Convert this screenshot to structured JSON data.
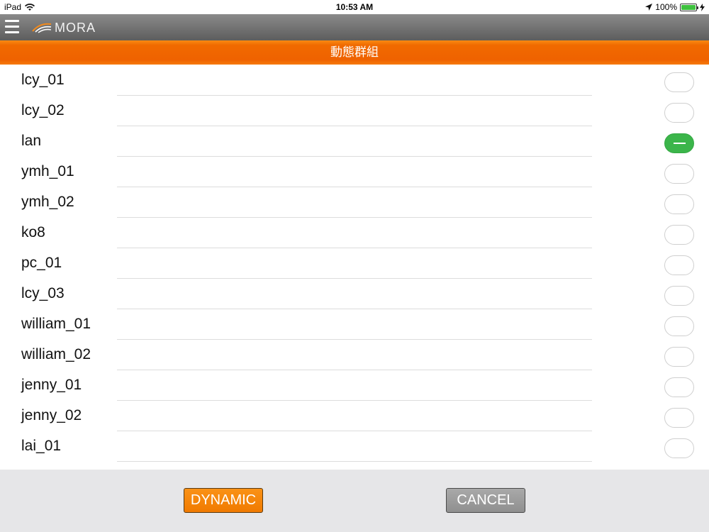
{
  "status_bar": {
    "device": "iPad",
    "time": "10:53 AM",
    "battery": "100%"
  },
  "header": {
    "app_name": "MORA"
  },
  "title": "動態群組",
  "colors": {
    "accent_orange": "#f06a00",
    "toggle_on": "#3bb54a",
    "header_gray": "#6e6e6e"
  },
  "items": [
    {
      "label": "lcy_01",
      "selected": false
    },
    {
      "label": "lcy_02",
      "selected": false
    },
    {
      "label": "lan",
      "selected": true
    },
    {
      "label": "ymh_01",
      "selected": false
    },
    {
      "label": "ymh_02",
      "selected": false
    },
    {
      "label": "ko8",
      "selected": false
    },
    {
      "label": "pc_01",
      "selected": false
    },
    {
      "label": "lcy_03",
      "selected": false
    },
    {
      "label": "william_01",
      "selected": false
    },
    {
      "label": "william_02",
      "selected": false
    },
    {
      "label": "jenny_01",
      "selected": false
    },
    {
      "label": "jenny_02",
      "selected": false
    },
    {
      "label": "lai_01",
      "selected": false
    }
  ],
  "footer": {
    "dynamic_label": "DYNAMIC",
    "cancel_label": "CANCEL"
  }
}
